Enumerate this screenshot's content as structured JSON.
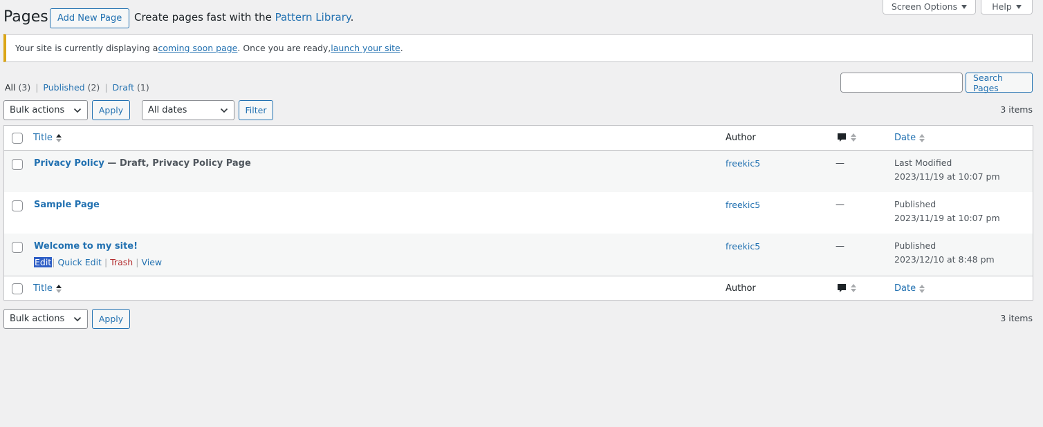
{
  "header": {
    "screen_options_label": "Screen Options",
    "help_label": "Help",
    "title": "Pages",
    "add_new_label": "Add New Page",
    "pattern_prefix": "Create pages fast with the ",
    "pattern_link": "Pattern Library",
    "pattern_suffix": "."
  },
  "notice": {
    "prefix": "Your site is currently displaying a ",
    "link1": "coming soon page",
    "middle": ". Once you are ready, ",
    "link2": "launch your site",
    "suffix": "."
  },
  "filters": {
    "views": [
      {
        "label": "All",
        "count": "(3)"
      },
      {
        "label": "Published",
        "count": "(2)"
      },
      {
        "label": "Draft",
        "count": "(1)"
      }
    ],
    "separator": "|",
    "search_button": "Search Pages",
    "bulk_actions": "Bulk actions",
    "apply": "Apply",
    "dates": "All dates",
    "filter": "Filter",
    "items_count": "3 items"
  },
  "table": {
    "columns": {
      "title": "Title",
      "author": "Author",
      "date": "Date"
    },
    "rows": [
      {
        "title": "Privacy Policy",
        "state": " — Draft, Privacy Policy Page",
        "author": "freekic5",
        "comments": "—",
        "date_status": "Last Modified",
        "date_value": "2023/11/19 at 10:07 pm"
      },
      {
        "title": "Sample Page",
        "state": "",
        "author": "freekic5",
        "comments": "—",
        "date_status": "Published",
        "date_value": "2023/11/19 at 10:07 pm"
      },
      {
        "title": "Welcome to my site!",
        "state": "",
        "author": "freekic5",
        "comments": "—",
        "date_status": "Published",
        "date_value": "2023/12/10 at 8:48 pm"
      }
    ],
    "row_actions": {
      "edit": "Edit",
      "quick_edit": "Quick Edit",
      "trash": "Trash",
      "view": "View",
      "separator": "|"
    }
  },
  "footer_controls": {
    "bulk_actions": "Bulk actions",
    "apply": "Apply",
    "items_count": "3 items"
  },
  "colors": {
    "link": "#2271b1",
    "notice_border": "#dba617",
    "trash": "#b32d2e",
    "selected_edit_bg": "#2f5fc6"
  }
}
